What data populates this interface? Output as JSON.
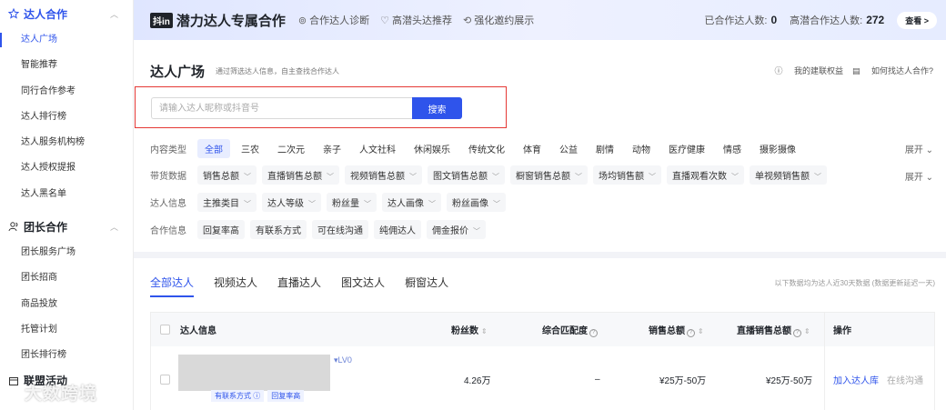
{
  "sidebar": {
    "groups": [
      {
        "label": "达人合作",
        "icon": "star-icon",
        "items": [
          "达人广场",
          "智能推荐",
          "同行合作参考",
          "达人排行榜",
          "达人服务机构榜",
          "达人授权提报",
          "达人黑名单"
        ]
      },
      {
        "label": "团长合作",
        "icon": "people-icon",
        "items": [
          "团长服务广场",
          "团长招商",
          "商品投放",
          "托管计划",
          "团长排行榜"
        ]
      },
      {
        "label": "联盟活动",
        "icon": "calendar-icon",
        "items": []
      }
    ],
    "active_item": "达人广场"
  },
  "banner": {
    "badge": "抖in",
    "title": "潜力达人专属合作",
    "links": [
      "合作达人诊断",
      "高潜头达推荐",
      "强化邀约展示"
    ],
    "stat1_label": "已合作达人数:",
    "stat1_value": "0",
    "stat2_label": "高潜合作达人数:",
    "stat2_value": "272",
    "view_label": "查看 >"
  },
  "page": {
    "title": "达人广场",
    "subtitle": "通过筛选达人信息，自主查找合作达人",
    "link_rights": "我的建联权益",
    "link_howto": "如何找达人合作?"
  },
  "search": {
    "placeholder": "请输入达人昵称或抖音号",
    "button": "搜索"
  },
  "filters": {
    "content_label": "内容类型",
    "content_types": [
      "全部",
      "三农",
      "二次元",
      "亲子",
      "人文社科",
      "休闲娱乐",
      "传统文化",
      "体育",
      "公益",
      "剧情",
      "动物",
      "医疗健康",
      "情感",
      "摄影摄像"
    ],
    "expand": "展开",
    "sales_label": "带货数据",
    "sales_dropdowns": [
      "销售总额",
      "直播销售总额",
      "视频销售总额",
      "图文销售总额",
      "橱窗销售总额",
      "场均销售额",
      "直播观看次数",
      "单视频销售额"
    ],
    "info_label": "达人信息",
    "info_dropdowns": [
      "主推类目",
      "达人等级",
      "粉丝量",
      "达人画像",
      "粉丝画像"
    ],
    "coop_label": "合作信息",
    "coop_chips": [
      "回复率高",
      "有联系方式",
      "可在线沟通",
      "纯佣达人"
    ],
    "coop_dropdown": "佣金报价"
  },
  "tabs": [
    "全部达人",
    "视频达人",
    "直播达人",
    "图文达人",
    "橱窗达人"
  ],
  "active_tab": "全部达人",
  "note": "以下数据均为达人近30天数据 (数据更新延迟一天)",
  "table": {
    "headers": {
      "info": "达人信息",
      "fans": "粉丝数",
      "match": "综合匹配度",
      "sales": "销售总额",
      "live_sales": "直播销售总额",
      "ops": "操作"
    },
    "rows": [
      {
        "level": "LV0",
        "tags": [
          "有联系方式",
          "回复率高"
        ],
        "fans": "4.26万",
        "match": "–",
        "sales": "¥25万-50万",
        "live_sales": "¥25万-50万",
        "op_add": "加入达人库",
        "op_chat": "在线沟通"
      }
    ]
  },
  "watermark": "大数跨境",
  "colors": {
    "accent": "#2f54eb",
    "highlight_border": "#e53935"
  }
}
